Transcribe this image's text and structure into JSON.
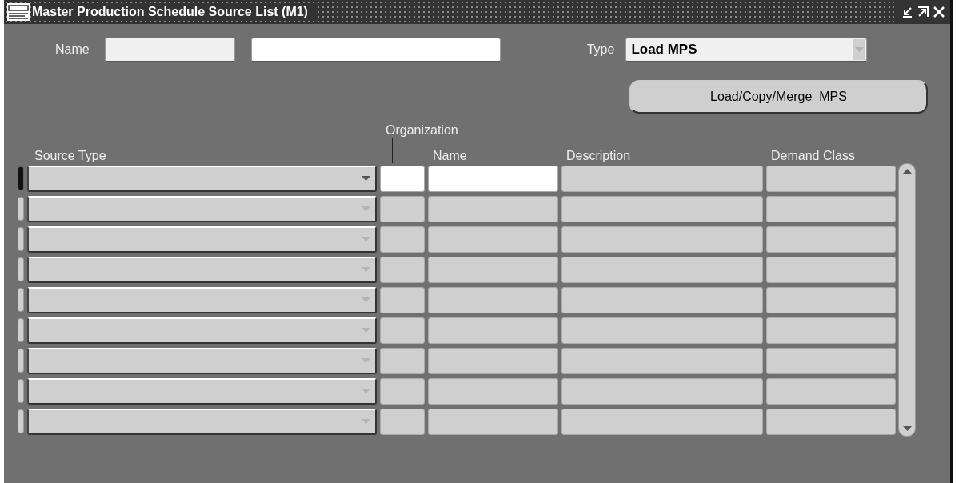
{
  "window": {
    "title": "Master Production Schedule Source List (M1)"
  },
  "header": {
    "name_label": "Name",
    "type_label": "Type",
    "type_value": "Load MPS"
  },
  "load_button": {
    "label": "Load/Copy/Merge  MPS"
  },
  "table": {
    "group_label": "Organization",
    "columns": [
      "Source Type",
      "Name",
      "Description",
      "Demand Class"
    ],
    "rows": [
      {
        "selected": true
      },
      {
        "selected": false
      },
      {
        "selected": false
      },
      {
        "selected": false
      },
      {
        "selected": false
      },
      {
        "selected": false
      },
      {
        "selected": false
      },
      {
        "selected": false
      },
      {
        "selected": false
      }
    ]
  }
}
